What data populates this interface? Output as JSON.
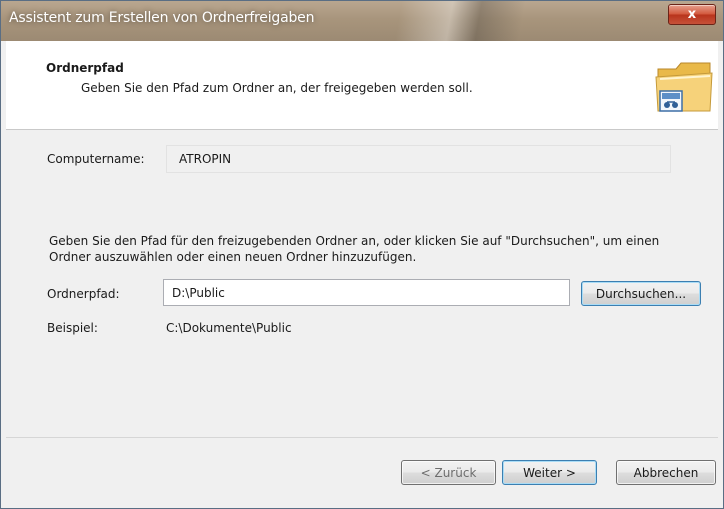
{
  "window": {
    "title": "Assistent zum Erstellen von Ordnerfreigaben",
    "close_label": "x"
  },
  "header": {
    "title": "Ordnerpfad",
    "subtitle": "Geben Sie den Pfad zum Ordner an, der freigegeben werden soll.",
    "icon": "folder-icon"
  },
  "computer": {
    "label": "Computername:",
    "value": "ATROPIN"
  },
  "instructions": "Geben Sie den Pfad für den freizugebenden Ordner an, oder klicken Sie auf \"Durchsuchen\", um einen Ordner auszuwählen oder einen neuen Ordner hinzuzufügen.",
  "path": {
    "label": "Ordnerpfad:",
    "value": "D:\\Public",
    "browse_label": "Durchsuchen..."
  },
  "example": {
    "label": "Beispiel:",
    "value": "C:\\Dokumente\\Public"
  },
  "footer": {
    "back_label": "< Zurück",
    "next_label": "Weiter >",
    "cancel_label": "Abbrechen"
  }
}
